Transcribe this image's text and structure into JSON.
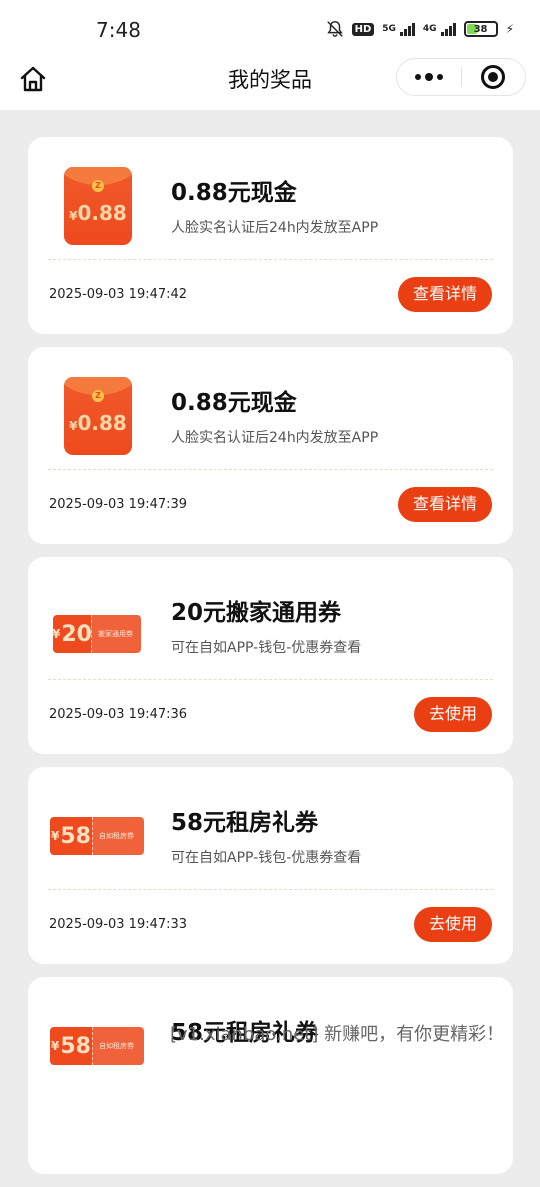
{
  "status_bar": {
    "time": "7:48",
    "hd": "HD",
    "net1": "5G",
    "net2": "4G",
    "battery": "38",
    "battery_level": 0.38
  },
  "nav": {
    "title": "我的奖品"
  },
  "cards": [
    {
      "type": "envelope",
      "thumb_currency": "¥",
      "thumb_amount": "0.88",
      "title": "0.88元现金",
      "desc": "人脸实名认证后24h内发放至APP",
      "time": "2025-09-03 19:47:42",
      "button": "查看详情"
    },
    {
      "type": "envelope",
      "thumb_currency": "¥",
      "thumb_amount": "0.88",
      "title": "0.88元现金",
      "desc": "人脸实名认证后24h内发放至APP",
      "time": "2025-09-03 19:47:39",
      "button": "查看详情"
    },
    {
      "type": "coupon",
      "thumb_currency": "¥",
      "thumb_amount": "20",
      "thumb_label": "搬家通用券",
      "title": "20元搬家通用券",
      "desc": "可在自如APP-钱包-优惠券查看",
      "time": "2025-09-03 19:47:36",
      "button": "去使用"
    },
    {
      "type": "coupon",
      "thumb_currency": "¥",
      "thumb_amount": "58",
      "thumb_label": "自如租房券",
      "title": "58元租房礼券",
      "desc": "可在自如APP-钱包-优惠券查看",
      "time": "2025-09-03 19:47:33",
      "button": "去使用"
    },
    {
      "type": "coupon",
      "thumb_currency": "¥",
      "thumb_amount": "58",
      "thumb_label": "自如租房券",
      "title": "58元租房礼券"
    }
  ],
  "watermark": "[v1.xianbao.net] 新赚吧，有你更精彩！"
}
